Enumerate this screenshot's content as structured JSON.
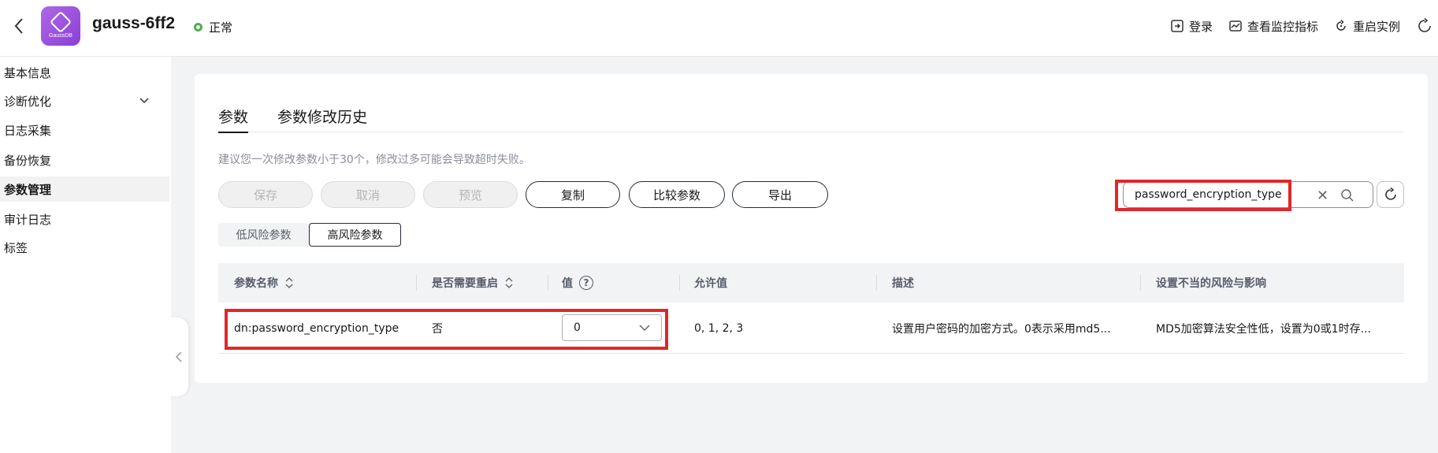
{
  "header": {
    "logo_text": "GaussDB",
    "instance_name": "gauss-6ff2",
    "status": "正常",
    "actions": {
      "login": "登录",
      "monitor": "查看监控指标",
      "restart": "重启实例"
    }
  },
  "sidebar": {
    "items": [
      {
        "label": "基本信息"
      },
      {
        "label": "诊断优化"
      },
      {
        "label": "日志采集"
      },
      {
        "label": "备份恢复"
      },
      {
        "label": "参数管理"
      },
      {
        "label": "审计日志"
      },
      {
        "label": "标签"
      }
    ],
    "active": "参数管理"
  },
  "tabs": [
    {
      "label": "参数"
    },
    {
      "label": "参数修改历史"
    }
  ],
  "tip": "建议您一次修改参数小于30个，修改过多可能会导致超时失败。",
  "toolbar": {
    "save": "保存",
    "cancel": "取消",
    "preview": "预览",
    "copy": "复制",
    "compare": "比较参数",
    "export": "导出"
  },
  "search": {
    "value": "password_encryption_type"
  },
  "risk_tabs": {
    "low": "低风险参数",
    "high": "高风险参数",
    "selected": "高风险参数"
  },
  "table": {
    "columns": {
      "name": "参数名称",
      "restart": "是否需要重启",
      "value": "值",
      "allowed": "允许值",
      "description": "描述",
      "risk": "设置不当的风险与影响"
    },
    "rows": [
      {
        "name": "dn:password_encryption_type",
        "restart": "否",
        "value": "0",
        "allowed": "0, 1, 2, 3",
        "description": "设置用户密码的加密方式。0表示采用md5...",
        "risk": "MD5加密算法安全性低，设置为0或1时存..."
      }
    ]
  },
  "colors": {
    "highlight": "#e0272a",
    "status_ok": "#4caf50",
    "logo": "#9b4fe0"
  }
}
